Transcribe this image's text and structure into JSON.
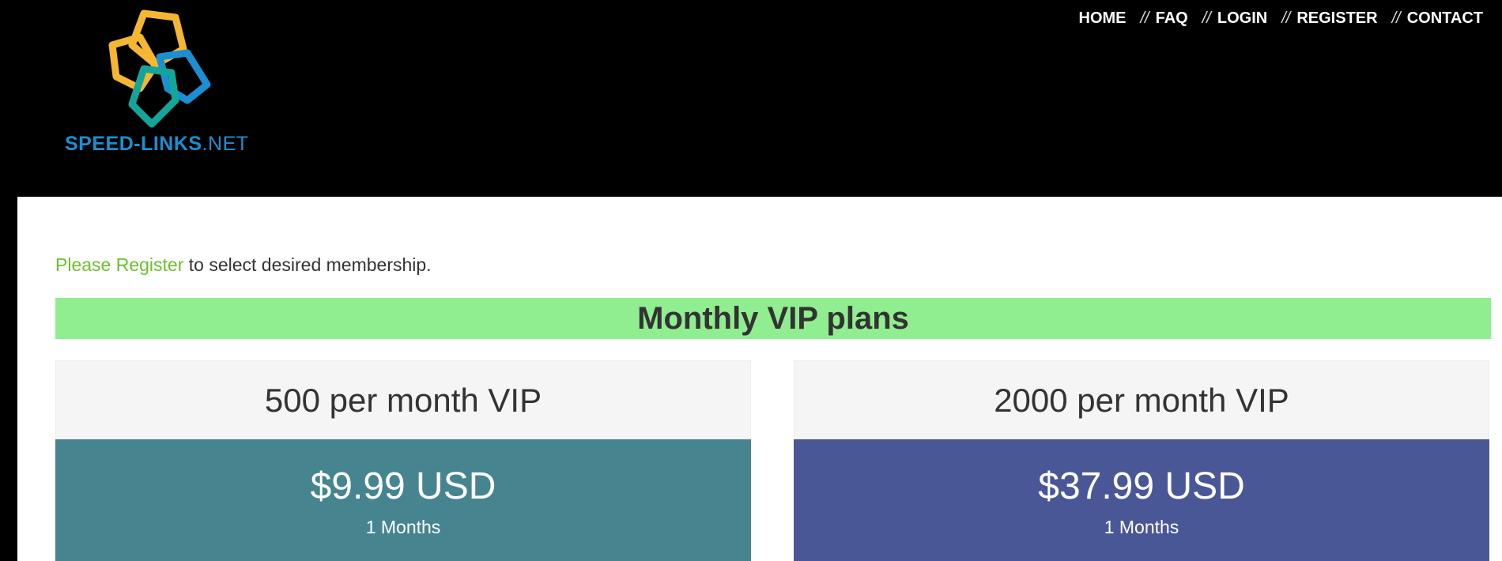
{
  "brand": {
    "logo_text_bold": "SPEED-LINKS",
    "logo_text_light": ".NET",
    "colors": {
      "yellow": "#f5b731",
      "blue": "#1b8fd2",
      "teal": "#14a59a"
    }
  },
  "nav": {
    "items": [
      {
        "label": "HOME"
      },
      {
        "label": "FAQ"
      },
      {
        "label": "LOGIN"
      },
      {
        "label": "REGISTER"
      },
      {
        "label": "CONTACT"
      }
    ],
    "separator": "//"
  },
  "notice": {
    "link_text": "Please Register",
    "rest_text": " to select desired membership."
  },
  "plans_section": {
    "title": "Monthly VIP plans",
    "banner_color": "#90ee90"
  },
  "plans": [
    {
      "name": "500 per month VIP",
      "price": "$9.99 USD",
      "term": "1 Months",
      "color": "#46858f"
    },
    {
      "name": "2000 per month VIP",
      "price": "$37.99 USD",
      "term": "1 Months",
      "color": "#4a5797"
    }
  ]
}
